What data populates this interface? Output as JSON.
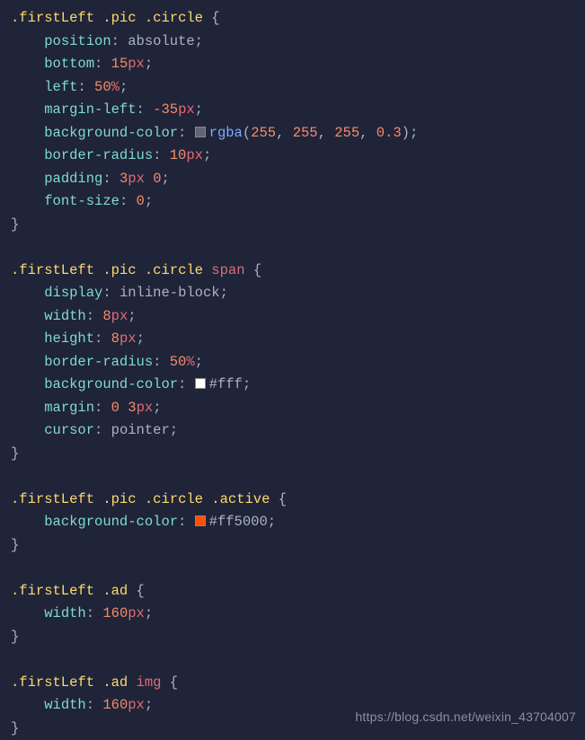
{
  "rules": [
    {
      "selector": [
        {
          "t": "sel",
          "v": ".firstLeft"
        },
        {
          "t": "sp"
        },
        {
          "t": "sel",
          "v": ".pic"
        },
        {
          "t": "sp"
        },
        {
          "t": "sel",
          "v": ".circle"
        }
      ],
      "decls": [
        {
          "prop": "position",
          "value": [
            {
              "t": "val",
              "v": "absolute"
            }
          ]
        },
        {
          "prop": "bottom",
          "value": [
            {
              "t": "num",
              "v": "15"
            },
            {
              "t": "unit",
              "v": "px"
            }
          ]
        },
        {
          "prop": "left",
          "value": [
            {
              "t": "num",
              "v": "50"
            },
            {
              "t": "unit",
              "v": "%"
            }
          ]
        },
        {
          "prop": "margin-left",
          "value": [
            {
              "t": "num",
              "v": "-35"
            },
            {
              "t": "unit",
              "v": "px"
            }
          ]
        },
        {
          "prop": "background-color",
          "value": [
            {
              "t": "swatch",
              "c": "rgba(255,255,255,0.3)"
            },
            {
              "t": "func",
              "v": "rgba"
            },
            {
              "t": "punct",
              "v": "("
            },
            {
              "t": "num",
              "v": "255"
            },
            {
              "t": "punct",
              "v": ", "
            },
            {
              "t": "num",
              "v": "255"
            },
            {
              "t": "punct",
              "v": ", "
            },
            {
              "t": "num",
              "v": "255"
            },
            {
              "t": "punct",
              "v": ", "
            },
            {
              "t": "num",
              "v": "0.3"
            },
            {
              "t": "punct",
              "v": ")"
            }
          ]
        },
        {
          "prop": "border-radius",
          "value": [
            {
              "t": "num",
              "v": "10"
            },
            {
              "t": "unit",
              "v": "px"
            }
          ]
        },
        {
          "prop": "padding",
          "value": [
            {
              "t": "num",
              "v": "3"
            },
            {
              "t": "unit",
              "v": "px"
            },
            {
              "t": "sp"
            },
            {
              "t": "num",
              "v": "0"
            }
          ]
        },
        {
          "prop": "font-size",
          "value": [
            {
              "t": "num",
              "v": "0"
            }
          ]
        }
      ]
    },
    {
      "selector": [
        {
          "t": "sel",
          "v": ".firstLeft"
        },
        {
          "t": "sp"
        },
        {
          "t": "sel",
          "v": ".pic"
        },
        {
          "t": "sp"
        },
        {
          "t": "sel",
          "v": ".circle"
        },
        {
          "t": "sp"
        },
        {
          "t": "tag",
          "v": "span"
        }
      ],
      "decls": [
        {
          "prop": "display",
          "value": [
            {
              "t": "val",
              "v": "inline-block"
            }
          ]
        },
        {
          "prop": "width",
          "value": [
            {
              "t": "num",
              "v": "8"
            },
            {
              "t": "unit",
              "v": "px"
            }
          ]
        },
        {
          "prop": "height",
          "value": [
            {
              "t": "num",
              "v": "8"
            },
            {
              "t": "unit",
              "v": "px"
            }
          ]
        },
        {
          "prop": "border-radius",
          "value": [
            {
              "t": "num",
              "v": "50"
            },
            {
              "t": "unit",
              "v": "%"
            }
          ]
        },
        {
          "prop": "background-color",
          "value": [
            {
              "t": "swatch",
              "c": "#fff"
            },
            {
              "t": "hex",
              "v": "#fff"
            }
          ]
        },
        {
          "prop": "margin",
          "value": [
            {
              "t": "num",
              "v": "0"
            },
            {
              "t": "sp"
            },
            {
              "t": "num",
              "v": "3"
            },
            {
              "t": "unit",
              "v": "px"
            }
          ]
        },
        {
          "prop": "cursor",
          "value": [
            {
              "t": "val",
              "v": "pointer"
            }
          ]
        }
      ]
    },
    {
      "selector": [
        {
          "t": "sel",
          "v": ".firstLeft"
        },
        {
          "t": "sp"
        },
        {
          "t": "sel",
          "v": ".pic"
        },
        {
          "t": "sp"
        },
        {
          "t": "sel",
          "v": ".circle"
        },
        {
          "t": "sp"
        },
        {
          "t": "sel",
          "v": ".active"
        }
      ],
      "decls": [
        {
          "prop": "background-color",
          "value": [
            {
              "t": "swatch",
              "c": "#ff5000"
            },
            {
              "t": "hex",
              "v": "#ff5000"
            }
          ]
        }
      ]
    },
    {
      "selector": [
        {
          "t": "sel",
          "v": ".firstLeft"
        },
        {
          "t": "sp"
        },
        {
          "t": "sel",
          "v": ".ad"
        }
      ],
      "decls": [
        {
          "prop": "width",
          "value": [
            {
              "t": "num",
              "v": "160"
            },
            {
              "t": "unit",
              "v": "px"
            }
          ]
        }
      ]
    },
    {
      "selector": [
        {
          "t": "sel",
          "v": ".firstLeft"
        },
        {
          "t": "sp"
        },
        {
          "t": "sel",
          "v": ".ad"
        },
        {
          "t": "sp"
        },
        {
          "t": "tag",
          "v": "img"
        }
      ],
      "decls": [
        {
          "prop": "width",
          "value": [
            {
              "t": "num",
              "v": "160"
            },
            {
              "t": "unit",
              "v": "px"
            }
          ]
        }
      ]
    }
  ],
  "watermark": "https://blog.csdn.net/weixin_43704007",
  "indent": "    "
}
